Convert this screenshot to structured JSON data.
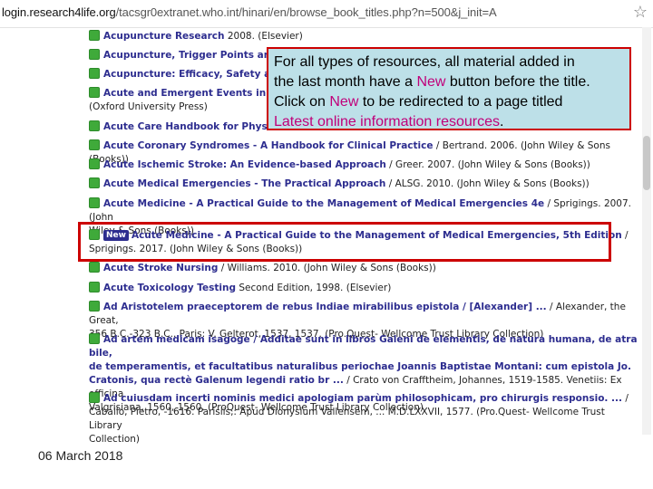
{
  "browser": {
    "url_host": "login.research4life.org",
    "url_path": "/tacsgr0extranet.who.int/hinari/en/browse_book_titles.php?n=500&j_init=A",
    "star": "☆"
  },
  "entries": [
    {
      "title": "Acupuncture Research",
      "info": " 2008. (Elsevier)"
    },
    {
      "title": "Acupuncture, Trigger Points and",
      "info": ""
    },
    {
      "title": "Acupuncture: Efficacy, Safety an",
      "info": ""
    },
    {
      "title": "Acute and Emergent Events in Sl",
      "info": "",
      "cont": "(Oxford University Press)"
    },
    {
      "title": "Acute Care Handbook for Physic",
      "info": ""
    },
    {
      "title": "Acute Coronary Syndromes - A Handbook for Clinical Practice",
      "info": " / Bertrand. 2006. (John Wiley & Sons (Books))"
    },
    {
      "title": "Acute Ischemic Stroke: An Evidence-based Approach",
      "info": " / Greer. 2007. (John Wiley & Sons (Books))"
    },
    {
      "title": "Acute Medical Emergencies - The Practical Approach",
      "info": " / ALSG. 2010. (John Wiley & Sons (Books))"
    },
    {
      "title": "Acute Medicine - A Practical Guide to the Management of Medical Emergencies 4e",
      "info": " / Sprigings. 2007. (John",
      "cont": "Wiley & Sons (Books))"
    },
    {
      "badge": "New",
      "title": "Acute Medicine - A Practical Guide to the Management of Medical Emergencies, 5th Edition",
      "info": " /",
      "cont": "Sprigings. 2017. (John Wiley & Sons (Books))"
    },
    {
      "title": "Acute Stroke Nursing",
      "info": " / Williams. 2010. (John Wiley & Sons (Books))"
    },
    {
      "title": "Acute Toxicology Testing",
      "info": " Second Edition, 1998. (Elsevier)"
    },
    {
      "title": "Ad Aristotelem praeceptorem de rebus Indiae mirabilibus epistola / [Alexander] ...",
      "info": " / Alexander, the Great,",
      "cont": "356 B.C.-323 B.C.. Paris: V. Gelterot, 1537, 1537. (Pro.Quest- Wellcome Trust Library Collection)"
    },
    {
      "title": "Ad artem medicam isagoge / Additae sunt in libros Galeni de elementis, de natura humana, de atra bile,",
      "info": "",
      "cont": "de temperamentis, et facultatibus naturalibus periochae Joannis Baptistae Montani: cum epistola Jo.",
      "cont_bold": true,
      "cont2": "Cratonis, qua rectè Galenum legendi ratio br ...",
      "cont2_info": " / Crato von Crafftheim, Johannes, 1519-1585. Venetiis: Ex officina",
      "cont3": "Valgrisiana, 1560, 1560. (ProQuest- Wellcome Trust Library Collection)"
    },
    {
      "title": "Ad cuiusdam incerti nominis medici apologiam parùm philosophicam, pro chirurgis responsio. ...",
      "info": " /",
      "cont": "Caballo, Pietro, -1616. Parisiis,: Apud Dionysium Vallensem, ... M.D.LXXVII, 1577. (Pro.Quest- Wellcome Trust Library",
      "cont2": "Collection)"
    }
  ],
  "callout": {
    "line1": "For all types of resources, all material added in",
    "line2_pre": "the last month have a ",
    "line2_new": "New",
    "line2_post": " button before the title.",
    "line3_pre": "Click on ",
    "line3_new": "New",
    "line3_post": " to be redirected to a page titled",
    "line4": "Latest online information resources",
    "line4_end": "."
  },
  "footer": {
    "date": "06 March 2018"
  },
  "colors": {
    "accent": "#c0007a",
    "highlight_border": "#cc0000",
    "callout_bg": "#bde0e8",
    "link": "#2d2d8f",
    "bullet": "#3faa3a"
  }
}
